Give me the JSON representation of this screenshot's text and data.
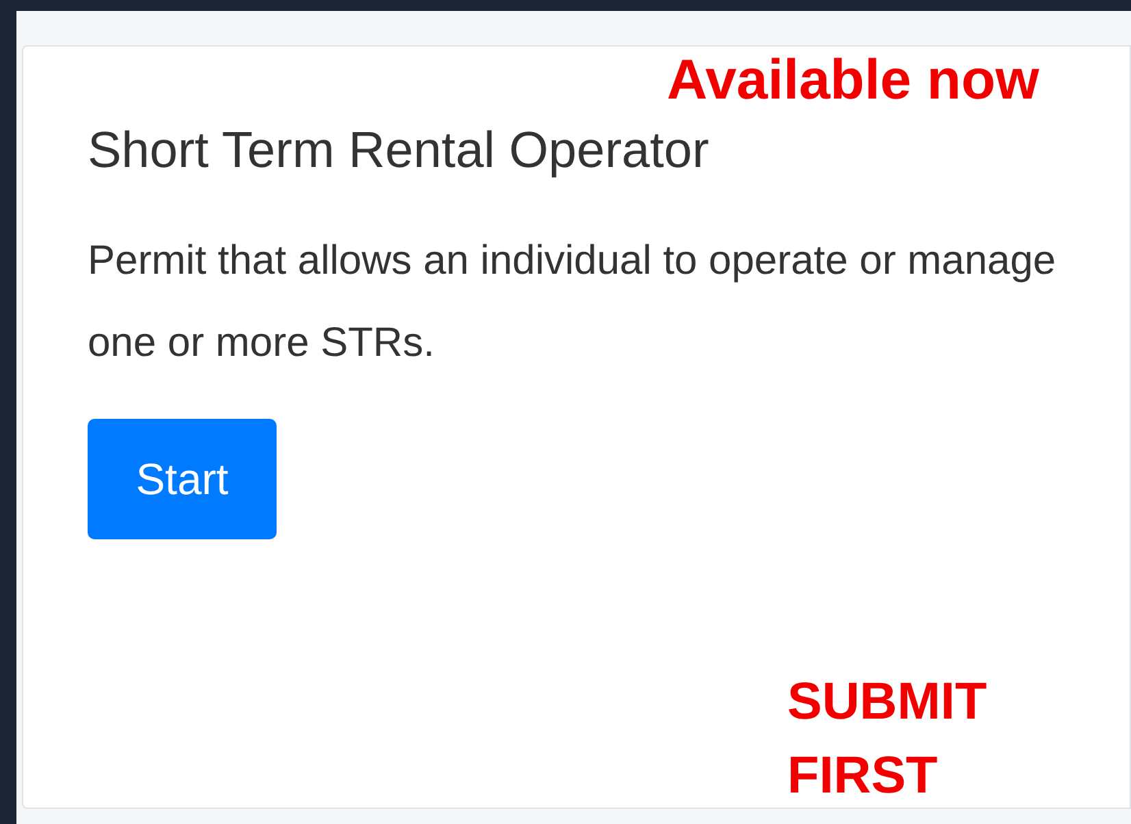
{
  "card": {
    "title": "Short Term Rental Operator",
    "description": "Permit that allows an individual to operate or manage one or more STRs.",
    "button": "Start"
  },
  "annotations": [
    {
      "text": "Available now"
    },
    {
      "text": "SUBMIT FIRST"
    }
  ]
}
